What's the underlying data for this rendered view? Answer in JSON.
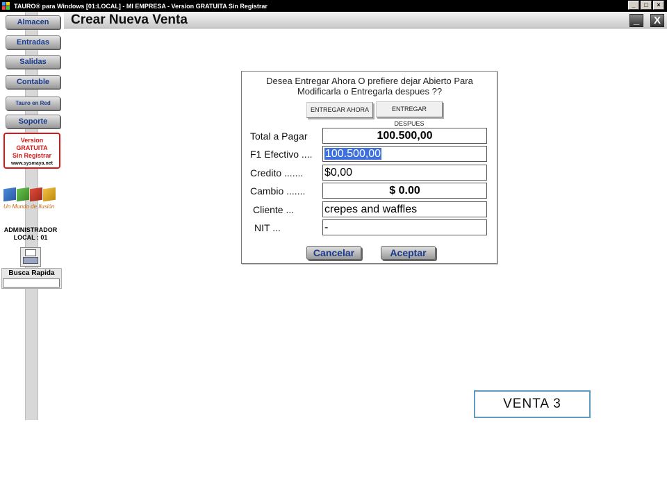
{
  "window": {
    "title": "TAURO® para Windows  [01:LOCAL] - MI EMPRESA - Version GRATUITA Sin Registrar",
    "controls": {
      "minimize": "_",
      "restore": "□",
      "close": "×"
    }
  },
  "toolbar": {
    "title": "Crear Nueva Venta",
    "minimize": "_",
    "close": "X"
  },
  "sidebar": {
    "items": [
      {
        "label": "Almacen"
      },
      {
        "label": "Entradas"
      },
      {
        "label": "Salidas"
      },
      {
        "label": "Contable"
      },
      {
        "label": "Tauro en Red"
      },
      {
        "label": "Soporte"
      }
    ],
    "badge": {
      "line1": "Version",
      "line2": "GRATUITA",
      "line3": "Sin Registrar",
      "url": "www.sysmaya.net"
    },
    "brand_tagline": "Un Mundo de Ilusión",
    "user": {
      "role": "ADMINISTRADOR",
      "location": "LOCAL : 01"
    },
    "search": {
      "label": "Busca Rapida",
      "value": ""
    }
  },
  "dialog": {
    "prompt": "Desea Entregar Ahora O prefiere dejar Abierto Para Modificarla o Entregarla despues ??",
    "options": {
      "now": "ENTREGAR AHORA",
      "later": "ENTREGAR DESPUES"
    },
    "fields": {
      "total": {
        "label": "Total a Pagar",
        "value": "100.500,00"
      },
      "cash": {
        "label": "F1  Efectivo ....",
        "value": "100.500,00"
      },
      "credit": {
        "label": "Credito .......",
        "value": "$0,00"
      },
      "change": {
        "label": "Cambio .......",
        "value": "$ 0.00"
      },
      "client": {
        "label": "Cliente ...",
        "value": "crepes and waffles"
      },
      "nit": {
        "label": "NIT ...",
        "value": "-"
      }
    },
    "buttons": {
      "cancel": "Cancelar",
      "accept": "Aceptar"
    }
  },
  "sale_tag": "VENTA  3",
  "colors": {
    "accent_blue": "#1a3a8c",
    "selection": "#3d6fdd",
    "badge_red": "#d81818",
    "tag_border": "#5e9bc0"
  }
}
